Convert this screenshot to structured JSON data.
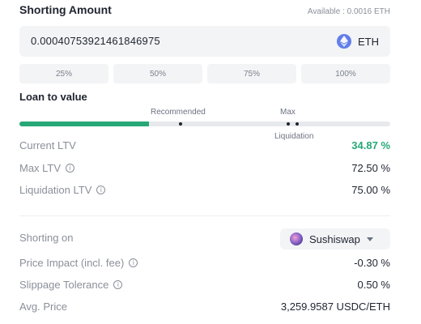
{
  "shorting_amount": {
    "title": "Shorting Amount",
    "available": "Available : 0.0016 ETH",
    "value": "0.00040753921461846975",
    "token": "ETH",
    "token_icon": "eth-icon"
  },
  "percent_buttons": [
    "25%",
    "50%",
    "75%",
    "100%"
  ],
  "ltv": {
    "title": "Loan to value",
    "recommended_label": "Recommended",
    "max_label": "Max",
    "liquidation_label": "Liquidation",
    "current_fraction": 0.3487,
    "fill_color": "#27a877"
  },
  "stats": {
    "current_ltv": {
      "label": "Current LTV",
      "value": "34.87 %"
    },
    "max_ltv": {
      "label": "Max LTV",
      "value": "72.50 %"
    },
    "liquidation_ltv": {
      "label": "Liquidation LTV",
      "value": "75.00 %"
    }
  },
  "trade": {
    "shorting_on": {
      "label": "Shorting on",
      "value": "Sushiswap",
      "icon": "sushiswap-icon"
    },
    "price_impact": {
      "label": "Price Impact (incl. fee)",
      "value": "-0.30 %"
    },
    "slippage": {
      "label": "Slippage Tolerance",
      "value": "0.50 %"
    },
    "avg_price": {
      "label": "Avg. Price",
      "value": "3,259.9587 USDC/ETH"
    }
  },
  "colors": {
    "accent_green": "#27a877",
    "eth_blue": "#627eea"
  }
}
